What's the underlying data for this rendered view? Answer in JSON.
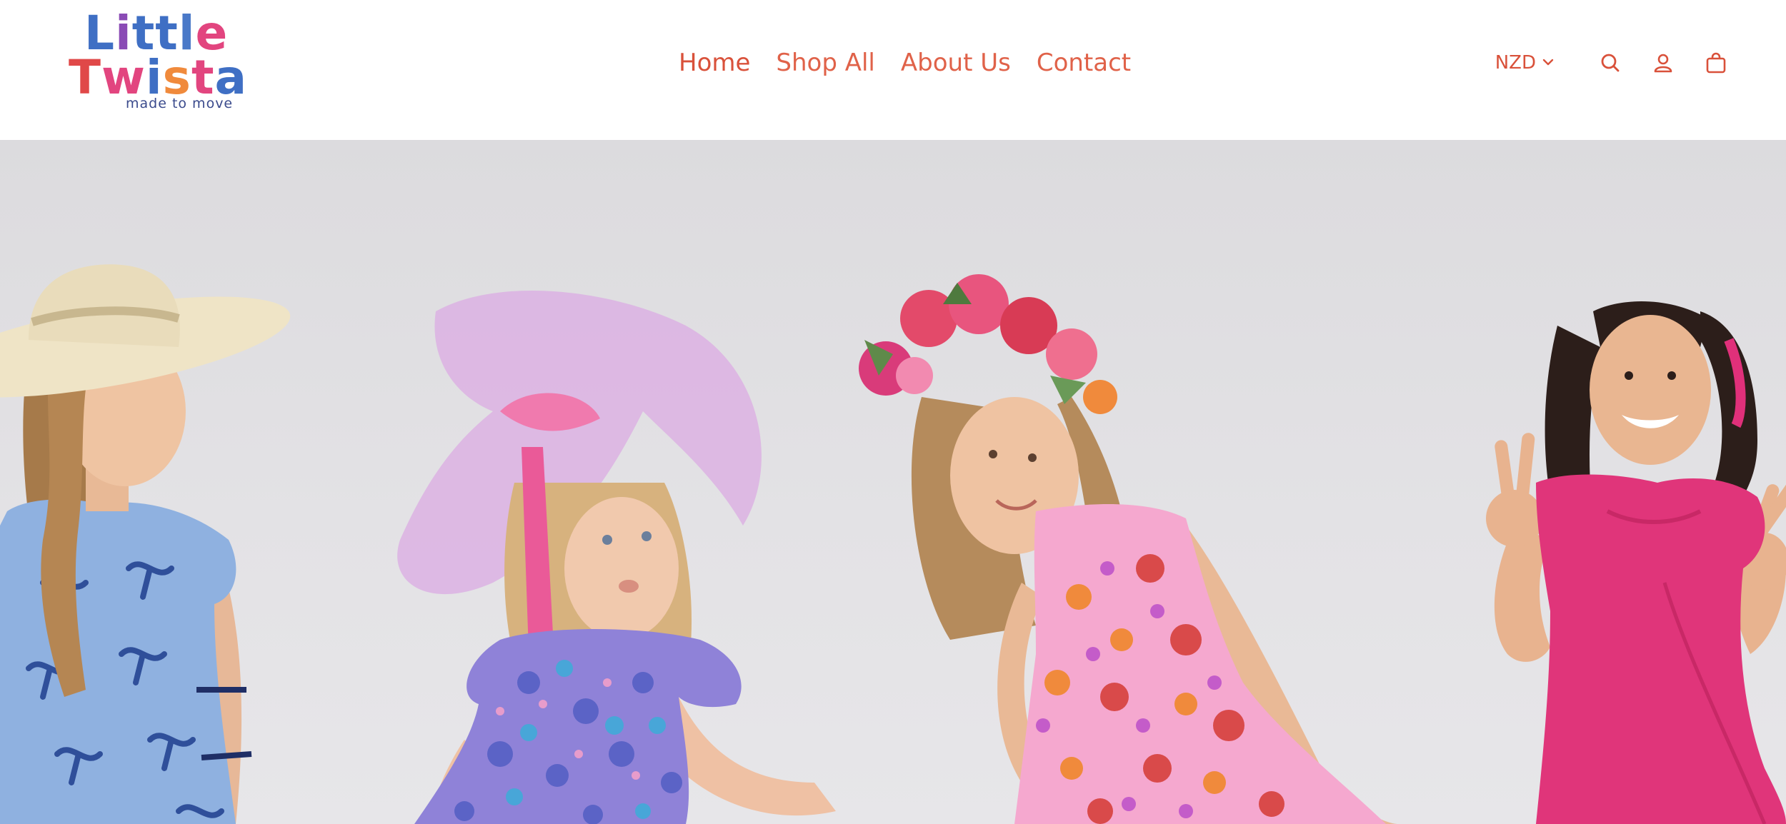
{
  "brand": {
    "logo_line1": "Little",
    "logo_line2": "Twista",
    "tagline": "made to move",
    "colors": {
      "blue": "#3f6fc4",
      "purple": "#8a4bb5",
      "pink": "#e2457f",
      "orange": "#f08a3c",
      "red": "#e04848",
      "navy": "#3a4a8c"
    }
  },
  "nav": {
    "items": [
      {
        "label": "Home",
        "active": true
      },
      {
        "label": "Shop All",
        "active": false
      },
      {
        "label": "About Us",
        "active": false
      },
      {
        "label": "Contact",
        "active": false
      }
    ]
  },
  "header_actions": {
    "currency": "NZD",
    "currency_icon": "chevron-down-icon",
    "search_icon": "search-icon",
    "account_icon": "account-icon",
    "cart_icon": "cart-icon"
  },
  "theme": {
    "accent": "#d9513a",
    "hero_background": "#e1e0e3"
  },
  "hero": {
    "image": "four girls in colorful dresses: blue bow-print dress with cowboy hat, purple floral dress with pink tulle bow, pink-orange floral dress with flower crown, solid magenta dress making peace signs"
  }
}
